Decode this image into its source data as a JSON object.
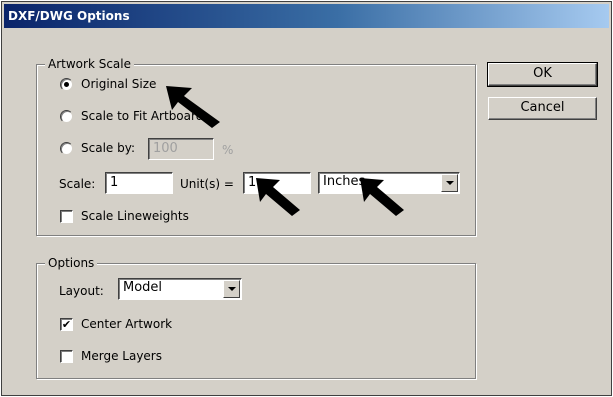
{
  "window": {
    "title": "DXF/DWG Options"
  },
  "artwork_scale": {
    "legend": "Artwork Scale",
    "original_size": {
      "label": "Original Size",
      "selected": true
    },
    "scale_to_fit": {
      "label": "Scale to Fit Artboard",
      "selected": false
    },
    "scale_by": {
      "label": "Scale by:",
      "selected": false,
      "value": "100",
      "unit": "%"
    },
    "scale_label": "Scale:",
    "scale_value": "1",
    "units_label": "Unit(s) =",
    "units_value": "1",
    "units_select": "Inches",
    "scale_lineweights": {
      "label": "Scale Lineweights",
      "checked": false
    }
  },
  "options": {
    "legend": "Options",
    "layout_label": "Layout:",
    "layout_value": "Model",
    "center_artwork": {
      "label": "Center Artwork",
      "checked": true,
      "mark": "✔"
    },
    "merge_layers": {
      "label": "Merge Layers",
      "checked": false
    }
  },
  "buttons": {
    "ok": "OK",
    "cancel": "Cancel"
  },
  "icons": {
    "pointer_arrow": "arrow-pointer-icon"
  }
}
